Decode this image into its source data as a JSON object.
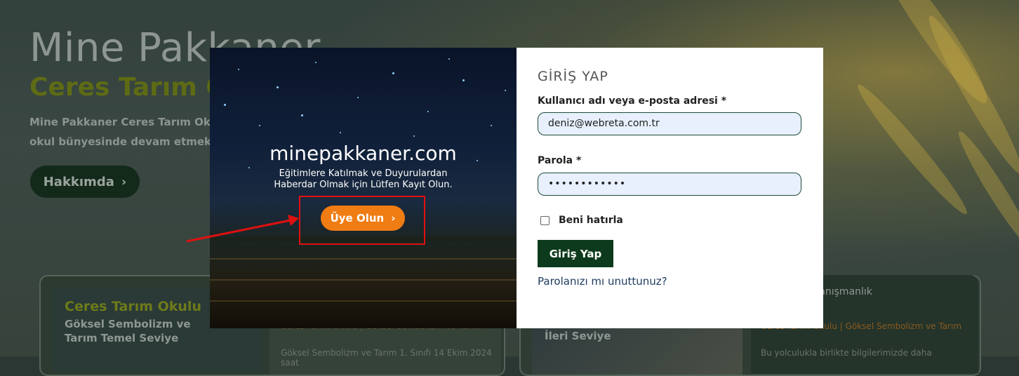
{
  "background": {
    "hero_title": "Mine Pakkaner",
    "hero_subtitle": "Ceres Tarım Okulu",
    "hero_text_line1": "Mine Pakkaner Ceres Tarım Okulu",
    "hero_text_line2": "okul bünyesinde devam etmekted",
    "about_button": "Hakkımda",
    "card_left": {
      "title": "Ceres Tarım Okulu",
      "subtitle": "Göksel Sembolizm ve Tarım Temel Seviye",
      "meta": "Ceres Tarım Okulu | Göksel Sembolizm ve Tarım",
      "body": "Göksel Sembolizm ve Tarım 1. Sınıfı 14 Ekim 2024 saat"
    },
    "card_right": {
      "image_label": "İleri Seviye",
      "heading": "r Tarımsal Danışmanlık",
      "orange_fragment": "e",
      "meta": "Ceres Tarım Okulu | Göksel Sembolizm ve Tarım",
      "body": "Bu yolculukla birlikte bilgilerimizde daha"
    }
  },
  "modal": {
    "promo": {
      "site_title": "minepakkaner.com",
      "description_line1": "Eğitimlere Katılmak ve  Duyurulardan",
      "description_line2": "Haberdar Olmak için Lütfen Kayıt Olun.",
      "register_button": "Üye Olun"
    },
    "login": {
      "title": "GİRİŞ YAP",
      "username_label": "Kullanıcı adı veya e-posta adresi *",
      "username_value": "deniz@webreta.com.tr",
      "password_label": "Parola *",
      "password_value": "••••••••••••",
      "remember_label": "Beni hatırla",
      "remember_checked": false,
      "submit_button": "Giriş Yap",
      "forgot_link": "Parolanızı mı unuttunuz?"
    }
  },
  "colors": {
    "accent_orange": "#f07c14",
    "brand_green": "#0d3a1c",
    "annotation_red": "#e01010"
  }
}
